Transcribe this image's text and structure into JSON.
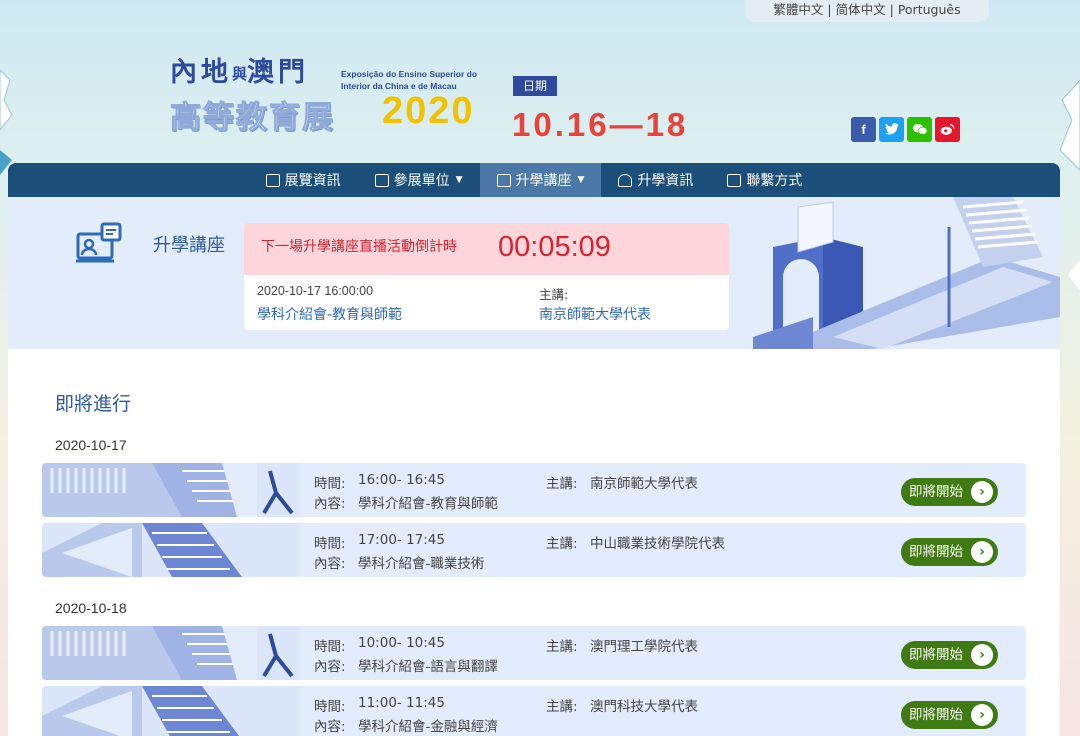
{
  "lang_bar": {
    "trad": "繁體中文",
    "simp": "简体中文",
    "pt": "Português",
    "sep": "|"
  },
  "header": {
    "logo_line1_a": "內地",
    "logo_line1_small": "與",
    "logo_line1_b": "澳門",
    "logo_pt_line1": "Exposição do Ensino Superior do",
    "logo_pt_line2": "Interior da China e de Macau",
    "logo_line2": "高等教育展",
    "logo_year": "2020",
    "date_badge": "日期",
    "date_range": "10.16—18"
  },
  "social": {
    "facebook": "f",
    "twitter": "t",
    "wechat": "w",
    "weibo": "wb",
    "colors": {
      "facebook": "#3b5bab",
      "twitter": "#1da1f2",
      "wechat": "#2dc100",
      "weibo": "#e6162d"
    }
  },
  "nav": {
    "items": [
      {
        "label": "展覽資訊",
        "dropdown": false,
        "active": false
      },
      {
        "label": "參展單位",
        "dropdown": true,
        "active": false
      },
      {
        "label": "升學講座",
        "dropdown": true,
        "active": true
      },
      {
        "label": "升學資訊",
        "dropdown": false,
        "active": false
      },
      {
        "label": "聯繫方式",
        "dropdown": false,
        "active": false
      }
    ]
  },
  "hero": {
    "title": "升學講座",
    "countdown_label": "下一場升學講座直播活動倒計時",
    "countdown_time": "00:05:09",
    "next_datetime": "2020-10-17 16:00:00",
    "next_topic": "學科介紹會-教育與師範",
    "speaker_label": "主講:",
    "next_speaker": "南京師範大學代表"
  },
  "upcoming": {
    "section_title": "即將進行",
    "time_label": "時間:",
    "content_label": "內容:",
    "speaker_label": "主講:",
    "days": [
      {
        "date": "2020-10-17",
        "sessions": [
          {
            "time": "16:00- 16:45",
            "content": "學科介紹會-教育與師範",
            "speaker": "南京師範大學代表",
            "status": "即將開始"
          },
          {
            "time": "17:00- 17:45",
            "content": "學科介紹會-職業技術",
            "speaker": "中山職業技術學院代表",
            "status": "即將開始"
          }
        ]
      },
      {
        "date": "2020-10-18",
        "sessions": [
          {
            "time": "10:00- 10:45",
            "content": "學科介紹會-語言與翻譯",
            "speaker": "澳門理工學院代表",
            "status": "即將開始"
          },
          {
            "time": "11:00- 11:45",
            "content": "學科介紹會-金融與經濟",
            "speaker": "澳門科技大學代表",
            "status": "即將開始"
          }
        ]
      }
    ]
  },
  "colors": {
    "nav_bg": "#1b4f7a",
    "nav_active": "#4b78a6",
    "accent_blue": "#2d5aa8",
    "countdown_red": "#d9232f",
    "date_red": "#e8423b",
    "year_yellow": "#f2c200",
    "button_green": "#3f7b12"
  }
}
